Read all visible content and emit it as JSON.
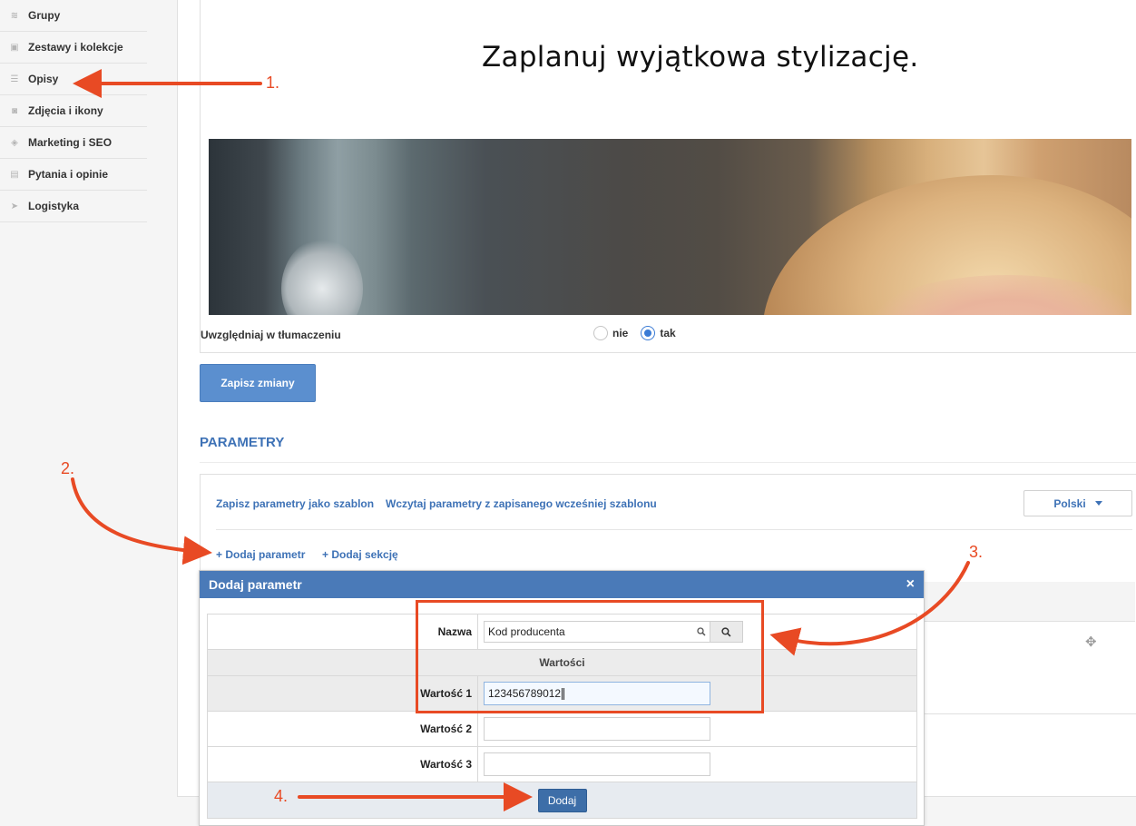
{
  "sidebar": {
    "items": [
      {
        "label": "Grupy",
        "icon": "layers-icon"
      },
      {
        "label": "Zestawy i kolekcje",
        "icon": "collection-icon"
      },
      {
        "label": "Opisy",
        "icon": "text-lines-icon"
      },
      {
        "label": "Zdjęcia i ikony",
        "icon": "camera-icon"
      },
      {
        "label": "Marketing i SEO",
        "icon": "megaphone-icon"
      },
      {
        "label": "Pytania i opinie",
        "icon": "chat-icon"
      },
      {
        "label": "Logistyka",
        "icon": "send-icon"
      }
    ]
  },
  "content": {
    "headline": "Zaplanuj wyjątkowa stylizację."
  },
  "translation": {
    "label": "Uwzględniaj w tłumaczeniu",
    "option_no": "nie",
    "option_yes": "tak",
    "selected": "tak"
  },
  "save_button": "Zapisz zmiany",
  "params": {
    "title": "PARAMETRY",
    "save_template": "Zapisz parametry jako szablon",
    "load_template": "Wczytaj parametry z zapisanego wcześniej szablonu",
    "language": "Polski",
    "add_param": "+  Dodaj parametr",
    "add_section": "+  Dodaj sekcję"
  },
  "modal": {
    "title": "Dodaj parametr",
    "close": "×",
    "name_label": "Nazwa",
    "name_value": "Kod producenta",
    "values_header": "Wartości",
    "value1_label": "Wartość 1",
    "value1": "123456789012",
    "value2_label": "Wartość 2",
    "value2": "",
    "value3_label": "Wartość 3",
    "value3": "",
    "submit": "Dodaj"
  },
  "annotations": {
    "step1": "1.",
    "step2": "2.",
    "step3": "3.",
    "step4": "4.",
    "color": "#e84a24"
  }
}
